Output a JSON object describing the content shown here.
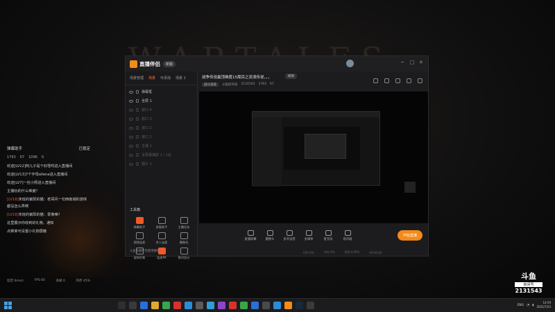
{
  "background": {
    "title_watermark": "WARTALES"
  },
  "chat_overlay": {
    "header_left": "弹幕助手",
    "header_right": "已锁定",
    "stats": [
      "1763",
      "67",
      "1096",
      "0"
    ],
    "messages": [
      {
        "level": "",
        "text": "欢迎[LV12]阿儿子是个好怪咬进入直播间"
      },
      {
        "level": "",
        "text": "欢迎[LV13]7个字母allena进入直播间"
      },
      {
        "level": "",
        "text": "欢迎[LV7]一任小熙进入直播间"
      },
      {
        "level": "",
        "text": "主播玩的什么难度？"
      },
      {
        "level": "[LV18]",
        "text": "末班的紫阳的猫：老哥问一句西南城的游侠都没怎么弄啊"
      },
      {
        "level": "[LV18]",
        "text": "末班的紫阳的猫：录像嘛?"
      },
      {
        "level": "",
        "text": "这里展示你收到的礼物、通知"
      },
      {
        "level": "",
        "text": "点菜单可设置小礼物屏蔽"
      }
    ],
    "footer": [
      "延迟 0ms/s",
      "FPS 60",
      "丢帧 0",
      "内存 45%"
    ]
  },
  "app": {
    "name": "直播伴侣",
    "version_tag": "新版",
    "window_controls": [
      "─",
      "□",
      "✕"
    ],
    "left_panel": {
      "tabs": [
        "场景管理",
        "场景",
        "可添加",
        "场景 1"
      ],
      "scenes": [
        {
          "name": "弹幕框",
          "dim": false
        },
        {
          "name": "全屏 1",
          "dim": false
        },
        {
          "name": "窗口 4",
          "dim": true
        },
        {
          "name": "窗口 3",
          "dim": true
        },
        {
          "name": "窗口 2",
          "dim": true
        },
        {
          "name": "窗口 1",
          "dim": true
        },
        {
          "name": "主播 1",
          "dim": true
        },
        {
          "name": "全屏幕捕获 1 / 1台",
          "dim": true
        },
        {
          "name": "图片 1",
          "dim": true
        }
      ],
      "tools_title": "工具箱",
      "tools": [
        "弹幕助手",
        "房管助手",
        "主播任务",
        "视频连麦",
        "多人连麦",
        "摄像机",
        "虚拟形象",
        "连麦PK",
        "歌词显示",
        "互动玩法",
        "弹幕游戏",
        "更多"
      ],
      "footer_note": "斗鱼直播伴侣使用教程"
    },
    "stream": {
      "title": "战争传说最顶难度15周目之流浪传说，，，",
      "edit_label": "修改",
      "category": "战斗竞技",
      "room_label": "斗鱼房间号",
      "room_id": "2131543",
      "popularity": "1763",
      "fans": "67"
    },
    "bottom_tools": [
      "直播屏幕",
      "摄像头",
      "多开运营",
      "多媒体",
      "麦克风",
      "扬声器"
    ],
    "live_button": "开始直播",
    "status": [
      "CPU 0%",
      "内存 0%",
      "丢帧 0.00%",
      "00:00:00"
    ]
  },
  "douyu_badge": {
    "brand": "斗鱼",
    "room_caption": "房间号",
    "room_number": "2131543"
  },
  "taskbar": {
    "lang": "ENG",
    "time": "14:59",
    "date": "2022/7/23"
  }
}
